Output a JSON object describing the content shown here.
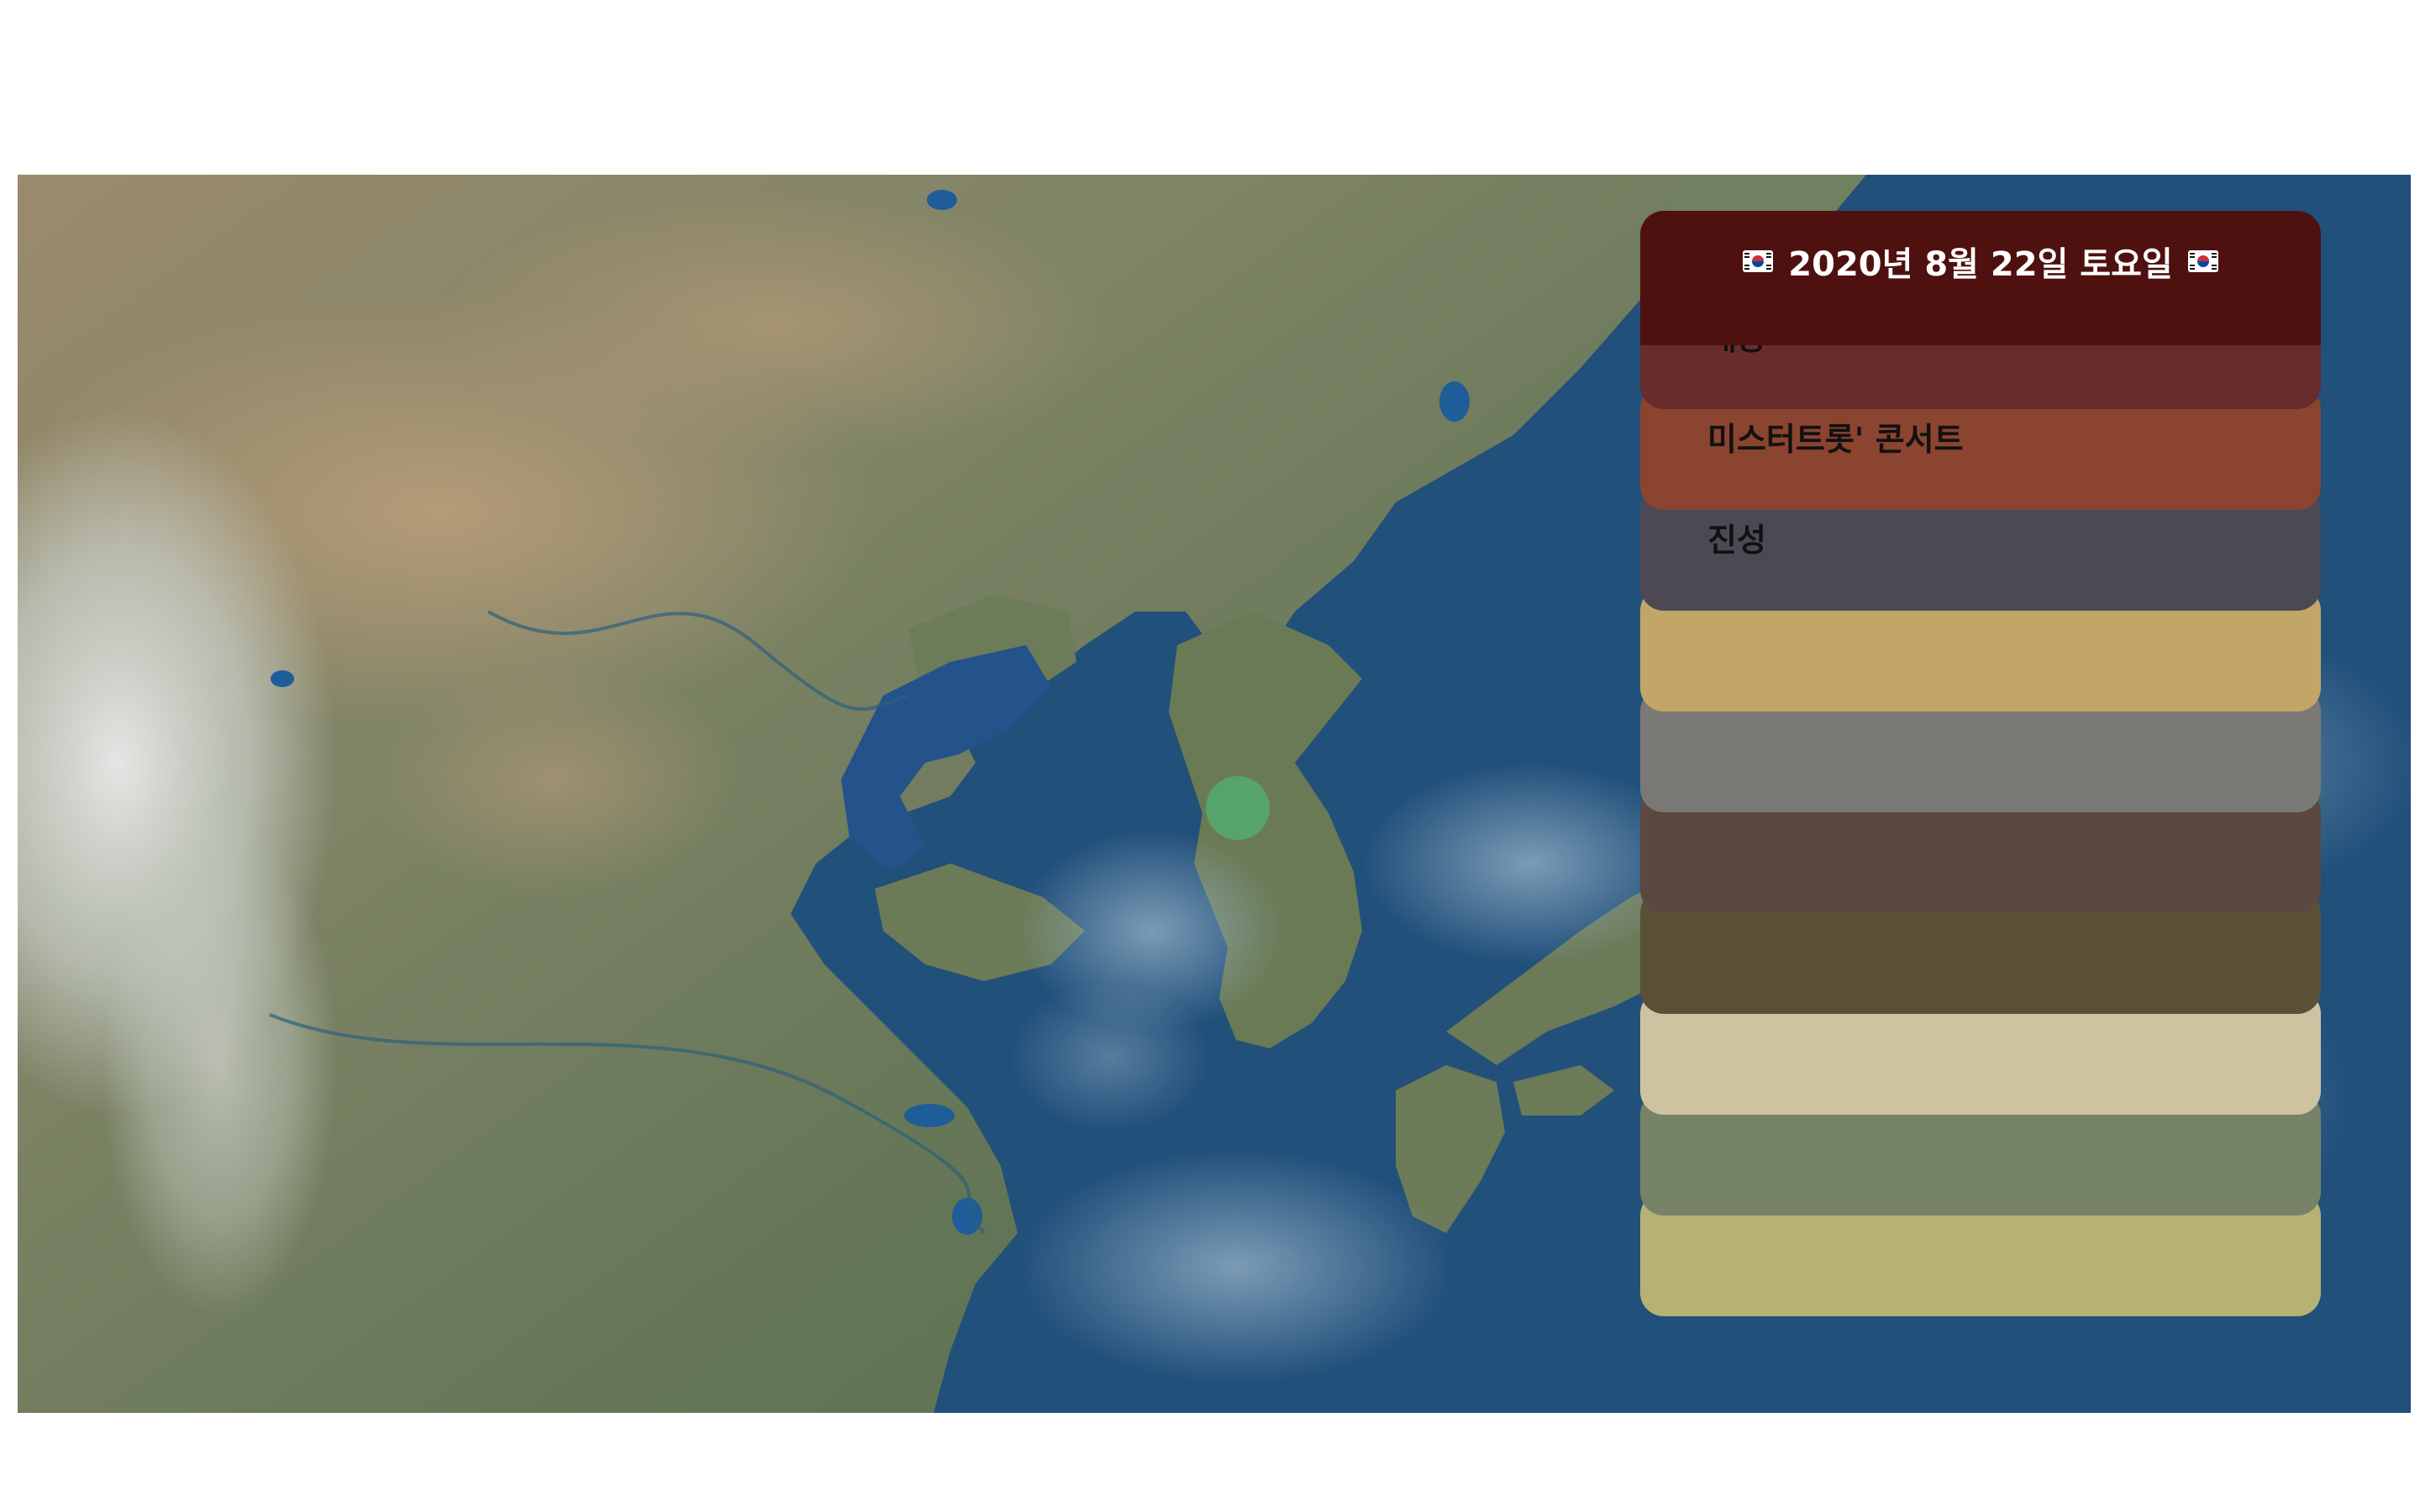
{
  "header": {
    "date_title": "2020년 8월 22일 토요일",
    "flag_icon": "korea-flag-icon"
  },
  "topics": [
    {
      "label": "태풍",
      "color": "#692c2c"
    },
    {
      "label": "미스터트롯' 콘서트",
      "color": "#8a4430"
    },
    {
      "label": "진성",
      "color": "#4c4954"
    },
    {
      "label": "",
      "color": "#c2a668"
    },
    {
      "label": "",
      "color": "#7b7975"
    },
    {
      "label": "",
      "color": "#5b4841"
    },
    {
      "label": "",
      "color": "#5a5035"
    },
    {
      "label": "",
      "color": "#cdc3a1"
    },
    {
      "label": "",
      "color": "#778367"
    },
    {
      "label": "",
      "color": "#b6b273"
    }
  ],
  "map": {
    "marker_color": "#57a46a",
    "ocean_color": "#21507b",
    "land_color": "#6b7e5a"
  }
}
